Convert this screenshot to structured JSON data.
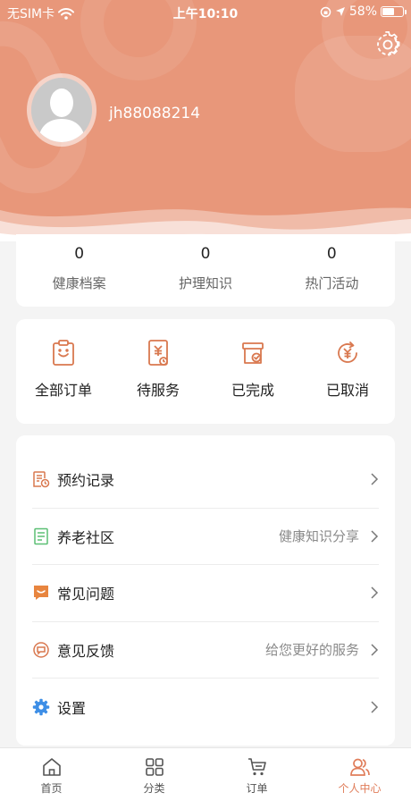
{
  "status_bar": {
    "carrier": "无SIM卡",
    "time": "上午10:10",
    "battery": "58%",
    "battery_level": 0.58
  },
  "profile": {
    "username": "jh88088214"
  },
  "stats": [
    {
      "value": "0",
      "label": "健康档案"
    },
    {
      "value": "0",
      "label": "护理知识"
    },
    {
      "value": "0",
      "label": "热门活动"
    }
  ],
  "orders": [
    {
      "label": "全部订单",
      "icon": "clipboard-icon"
    },
    {
      "label": "待服务",
      "icon": "yuan-document-icon"
    },
    {
      "label": "已完成",
      "icon": "box-check-icon"
    },
    {
      "label": "已取消",
      "icon": "yuan-refund-icon"
    }
  ],
  "menu": [
    {
      "label": "预约记录",
      "hint": "",
      "icon": "appointment-record-icon"
    },
    {
      "label": "养老社区",
      "hint": "健康知识分享",
      "icon": "document-list-icon"
    },
    {
      "label": "常见问题",
      "hint": "",
      "icon": "chat-bubble-icon"
    },
    {
      "label": "意见反馈",
      "hint": "给您更好的服务",
      "icon": "feedback-icon"
    },
    {
      "label": "设置",
      "hint": "",
      "icon": "gear-icon"
    }
  ],
  "tabs": [
    {
      "label": "首页",
      "icon": "home-icon",
      "active": false
    },
    {
      "label": "分类",
      "icon": "grid-icon",
      "active": false
    },
    {
      "label": "订单",
      "icon": "cart-icon",
      "active": false
    },
    {
      "label": "个人中心",
      "icon": "user-icon",
      "active": true
    }
  ],
  "colors": {
    "header": "#e8977a",
    "accent": "#e07d5a",
    "icon_orange": "#d9784f",
    "icon_green": "#5bbf74",
    "icon_blue": "#3d8ee6"
  }
}
